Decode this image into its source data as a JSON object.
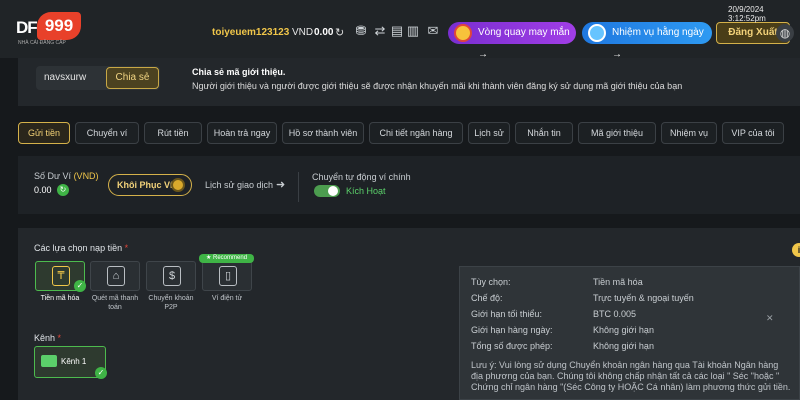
{
  "header": {
    "logo_text": "DF999",
    "logo_sub": "NHÀ CÁI ĐẲNG CẤP",
    "username": "toiyeuem123123",
    "currency": "VND",
    "balance": "0.00",
    "lucky_wheel_label": "Vòng quay may mắn",
    "mission_label": "Nhiệm vụ hằng ngày",
    "logout_label": "Đăng Xuất",
    "datetime": "20/9/2024 3:12:52pm"
  },
  "referral": {
    "code": "navsxurw",
    "share_label": "Chia sẻ",
    "title": "Chia sẻ mã giới thiệu.",
    "description": "Người giới thiệu và người được giới thiệu sẽ được nhận khuyến mãi khi thành viên đăng ký sử dụng mã giới thiệu của bạn"
  },
  "tabs": [
    {
      "label": "Gửi tiền",
      "active": true
    },
    {
      "label": "Chuyển ví"
    },
    {
      "label": "Rút tiền"
    },
    {
      "label": "Hoàn trả ngay"
    },
    {
      "label": "Hồ sơ thành viên"
    },
    {
      "label": "Chi tiết ngân hàng"
    },
    {
      "label": "Lịch sử"
    },
    {
      "label": "Nhắn tin"
    },
    {
      "label": "Mã giới thiệu"
    },
    {
      "label": "Nhiệm vụ"
    },
    {
      "label": "VIP của tôi"
    }
  ],
  "wallet": {
    "label": "Số Dư Ví",
    "label_currency": "(VND)",
    "balance": "0.00",
    "restore_label": "Khôi Phục Ví",
    "history_label": "Lịch sử giao dịch",
    "auto_transfer_label": "Chuyển tự động ví chính",
    "toggle_state": "Kích Hoạt"
  },
  "deposit": {
    "options_title": "Các lựa chọn nạp tiền",
    "required_mark": "*",
    "recommend_badge": "★ Recommend",
    "methods": [
      {
        "label": "Tiền mã hóa",
        "icon": "crypto-icon",
        "selected": true
      },
      {
        "label": "Quét mã thanh toán",
        "icon": "bank-icon"
      },
      {
        "label": "Chuyển khoản P2P",
        "icon": "p2p-icon"
      },
      {
        "label": "Ví điện tử",
        "icon": "ewallet-icon"
      }
    ],
    "channel_title": "Kênh",
    "channel_label": "Kênh 1"
  },
  "details": {
    "rows": [
      {
        "key": "Tùy chọn:",
        "value": "Tiền mã hóa"
      },
      {
        "key": "Chế độ:",
        "value": "Trực tuyến & ngoại tuyến"
      },
      {
        "key": "Giới hạn tối thiểu:",
        "value": "BTC 0.005"
      },
      {
        "key": "Giới hạn hàng ngày:",
        "value": "Không giới hạn"
      },
      {
        "key": "Tổng số được phép:",
        "value": "Không giới hạn"
      }
    ],
    "note": "Lưu ý: Vui lòng sử dụng Chuyển khoản ngân hàng qua Tài khoản Ngân hàng địa phương của bạn. Chúng tôi không chấp nhận tất cả các loại \" Séc \"hoặc \" Chứng chỉ ngân hàng \"(Séc Công ty HOẶC Cá nhân) làm phương thức gửi tiền."
  },
  "colors": {
    "accent_gold": "#f0c64a",
    "success_green": "#3fb446",
    "background": "#16191c"
  }
}
